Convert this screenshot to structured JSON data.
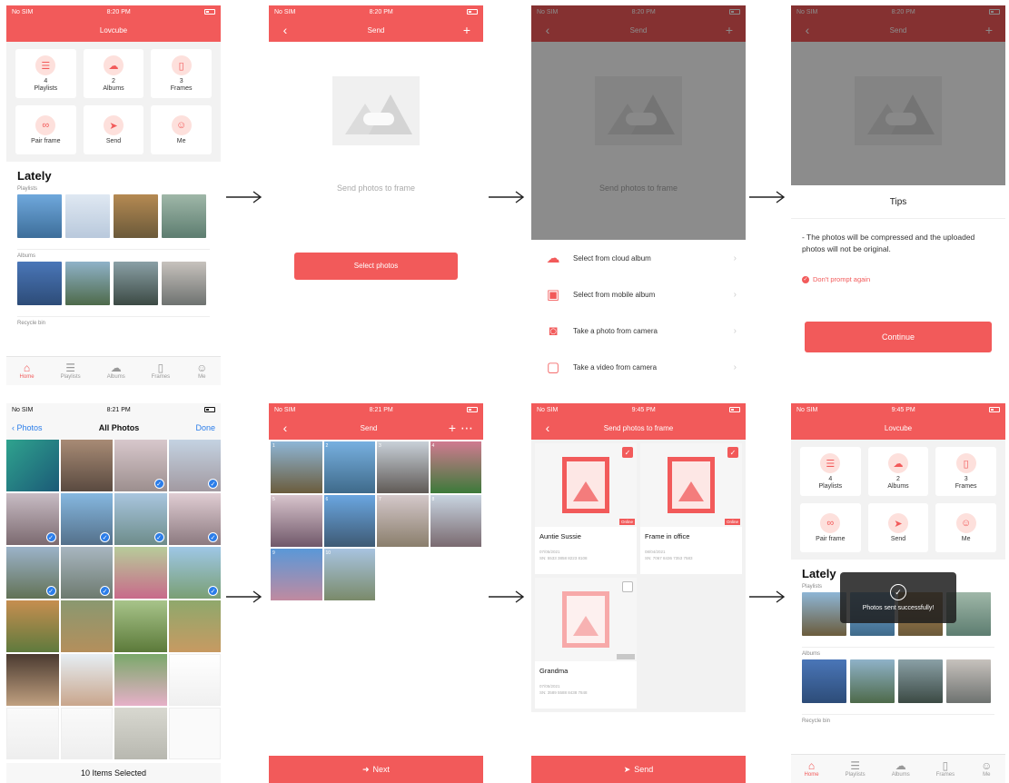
{
  "status": {
    "carrier": "No SIM",
    "times": [
      "8:20 PM",
      "8:20 PM",
      "8:20 PM",
      "8:20 PM",
      "8:21 PM",
      "8:21 PM",
      "9:45 PM",
      "9:45 PM"
    ]
  },
  "colors": {
    "accent": "#f25a5a",
    "ios_blue": "#2b7de9"
  },
  "home": {
    "title": "Lovcube",
    "tiles": [
      {
        "icon": "list-icon",
        "count": "4",
        "label": "Playlists"
      },
      {
        "icon": "cloud-icon",
        "count": "2",
        "label": "Albums"
      },
      {
        "icon": "frame-icon",
        "count": "3",
        "label": "Frames"
      },
      {
        "icon": "link-icon",
        "count": "",
        "label": "Pair frame"
      },
      {
        "icon": "send-icon",
        "count": "",
        "label": "Send"
      },
      {
        "icon": "person-icon",
        "count": "",
        "label": "Me"
      }
    ],
    "lately": "Lately",
    "sections": {
      "playlists": "Playlists",
      "albums": "Albums",
      "recycle": "Recycle bin"
    }
  },
  "tabbar": {
    "home": "Home",
    "playlists": "Playlists",
    "albums": "Albums",
    "frames": "Frames",
    "me": "Me"
  },
  "send": {
    "title": "Send",
    "caption": "Send photos to frame",
    "select_button": "Select photos"
  },
  "sheet": {
    "items": [
      {
        "icon": "cloud-icon",
        "label": "Select from cloud album"
      },
      {
        "icon": "image-icon",
        "label": "Select from mobile album"
      },
      {
        "icon": "camera-icon",
        "label": "Take a photo from camera"
      },
      {
        "icon": "video-icon",
        "label": "Take a video from camera"
      }
    ]
  },
  "tips": {
    "title": "Tips",
    "text": "- The photos will be compressed and the uploaded photos will not be original.",
    "dont_prompt": "Don't prompt again",
    "continue": "Continue"
  },
  "picker": {
    "back": "Photos",
    "title": "All Photos",
    "done": "Done",
    "footer": "10 Items Selected"
  },
  "selected": {
    "title": "Send",
    "next": "Next",
    "numbers": [
      "1",
      "2",
      "3",
      "4",
      "5",
      "6",
      "7",
      "8",
      "9",
      "10"
    ]
  },
  "frames": {
    "title": "Send photos to frame",
    "online": "Online",
    "items": [
      {
        "name": "Auntie Sussie",
        "date": "07/05/2021",
        "sn": "SN: 5533 3858 8223 8108"
      },
      {
        "name": "Frame in office",
        "date": "08/04/2021",
        "sn": "SN: 7067 8436 7353 7583"
      },
      {
        "name": "Grandma",
        "date": "07/05/2021",
        "sn": "SN: 3589 5588 8438 7848"
      }
    ],
    "send_button": "Send"
  },
  "toast": {
    "message": "Photos sent successfully!"
  }
}
